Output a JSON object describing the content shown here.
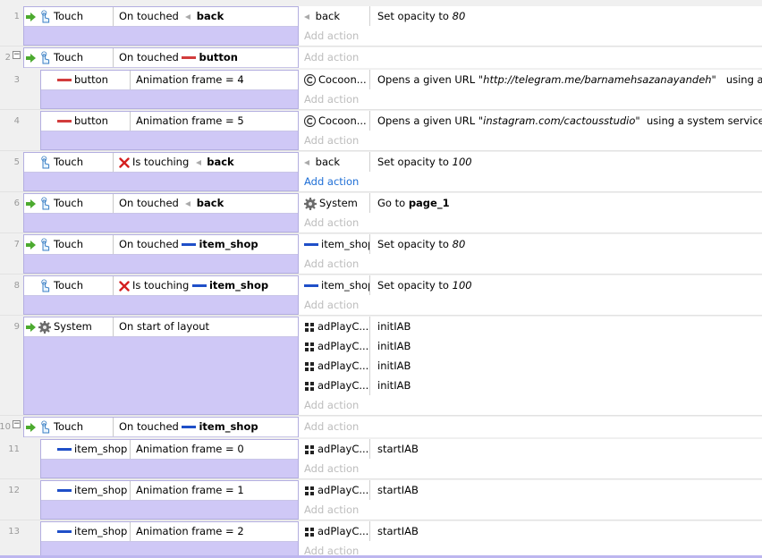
{
  "labels": {
    "touch": "Touch",
    "system": "System",
    "on_touched": "On touched",
    "is_touching": "Is touching",
    "on_start_of_layout": "On start of layout",
    "back": "back",
    "button": "button",
    "item_shop": "item_shop",
    "add_action": "Add action",
    "set_opacity_to": "Set opacity to",
    "go_to": "Go to",
    "page_1": "page_1",
    "cocoon": "Cocoon...",
    "adplay": "adPlayC...",
    "initiab": "initIAB",
    "startiab": "startIAB",
    "opens_url": "Opens a given URL",
    "url_telegram": "\"http://telegram.me/barnamehsazanayandeh\"",
    "url_instagram": "\"instagram.com/cactousstudio\"",
    "tail_1": "using a system",
    "tail_2": "using a system service that is a",
    "anim_frame": "Animation frame ="
  },
  "values": {
    "opacity_80": "80",
    "opacity_100": "100",
    "frame_4": "4",
    "frame_5": "5",
    "frame_0": "0",
    "frame_1": "1",
    "frame_2": "2"
  },
  "events": [
    {
      "line": "1"
    },
    {
      "line": "2"
    },
    {
      "line": "3"
    },
    {
      "line": "4"
    },
    {
      "line": "5"
    },
    {
      "line": "6"
    },
    {
      "line": "7"
    },
    {
      "line": "8"
    },
    {
      "line": "9"
    },
    {
      "line": "10"
    },
    {
      "line": "11"
    },
    {
      "line": "12"
    },
    {
      "line": "13"
    }
  ],
  "colors": {
    "condition_block": "#cfc8f6",
    "red_sprite": "#d23c3c",
    "blue_sprite": "#1f4fc8",
    "add_action_active": "#1f6fd6"
  }
}
